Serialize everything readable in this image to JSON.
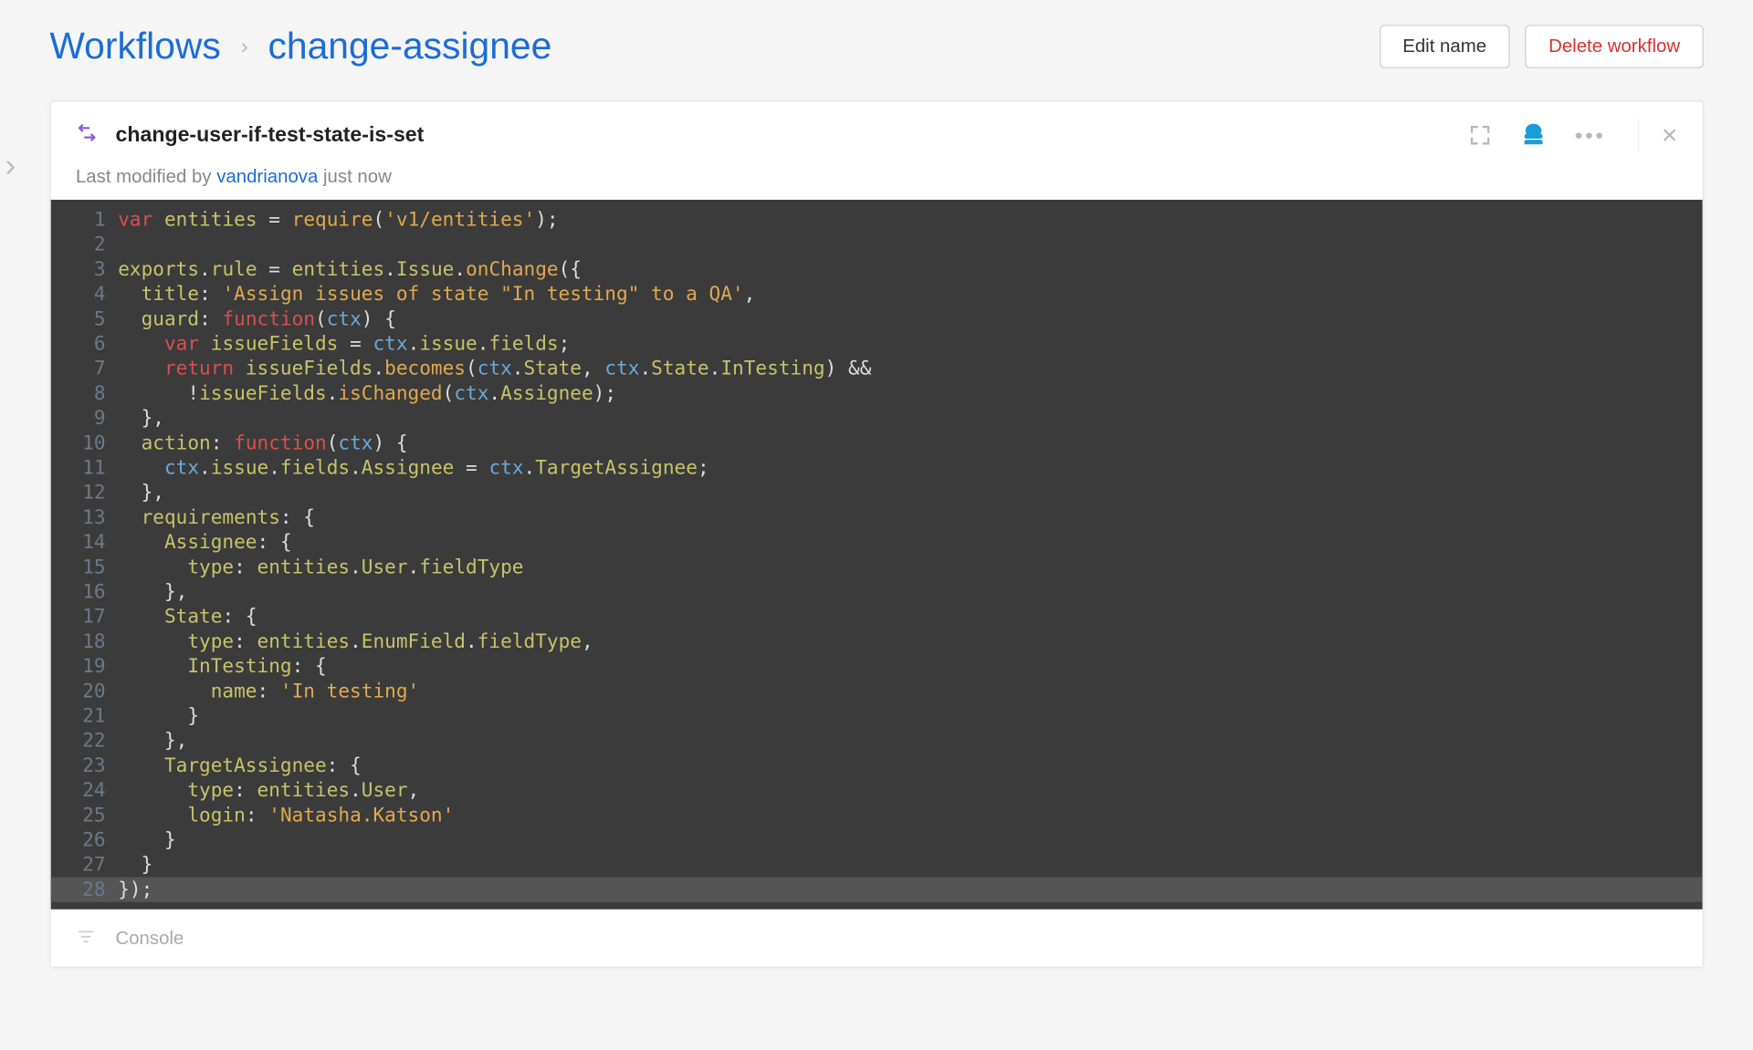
{
  "breadcrumb": {
    "root": "Workflows",
    "current": "change-assignee"
  },
  "buttons": {
    "edit": "Edit name",
    "delete": "Delete workflow"
  },
  "panel": {
    "title": "change-user-if-test-state-is-set",
    "meta_prefix": "Last modified by ",
    "meta_user": "vandrianova",
    "meta_time": " just now"
  },
  "console": {
    "label": "Console"
  },
  "code": [
    [
      [
        "kw",
        "var"
      ],
      [
        "op",
        " "
      ],
      [
        "prop",
        "entities"
      ],
      [
        "op",
        " "
      ],
      [
        "punc",
        "="
      ],
      [
        "op",
        " "
      ],
      [
        "fn",
        "require"
      ],
      [
        "punc",
        "("
      ],
      [
        "str",
        "'v1/entities'"
      ],
      [
        "punc",
        ");"
      ]
    ],
    [],
    [
      [
        "prop",
        "exports"
      ],
      [
        "punc",
        "."
      ],
      [
        "prop",
        "rule"
      ],
      [
        "op",
        " "
      ],
      [
        "punc",
        "="
      ],
      [
        "op",
        " "
      ],
      [
        "prop",
        "entities"
      ],
      [
        "punc",
        "."
      ],
      [
        "prop",
        "Issue"
      ],
      [
        "punc",
        "."
      ],
      [
        "fn",
        "onChange"
      ],
      [
        "punc",
        "({"
      ]
    ],
    [
      [
        "op",
        "  "
      ],
      [
        "prop",
        "title"
      ],
      [
        "punc",
        ":"
      ],
      [
        "op",
        " "
      ],
      [
        "str",
        "'Assign issues of state \"In testing\" to a QA'"
      ],
      [
        "punc",
        ","
      ]
    ],
    [
      [
        "op",
        "  "
      ],
      [
        "prop",
        "guard"
      ],
      [
        "punc",
        ":"
      ],
      [
        "op",
        " "
      ],
      [
        "kw",
        "function"
      ],
      [
        "punc",
        "("
      ],
      [
        "id",
        "ctx"
      ],
      [
        "punc",
        ")"
      ],
      [
        "op",
        " "
      ],
      [
        "punc",
        "{"
      ]
    ],
    [
      [
        "op",
        "    "
      ],
      [
        "kw",
        "var"
      ],
      [
        "op",
        " "
      ],
      [
        "prop",
        "issueFields"
      ],
      [
        "op",
        " "
      ],
      [
        "punc",
        "="
      ],
      [
        "op",
        " "
      ],
      [
        "id",
        "ctx"
      ],
      [
        "punc",
        "."
      ],
      [
        "prop",
        "issue"
      ],
      [
        "punc",
        "."
      ],
      [
        "prop",
        "fields"
      ],
      [
        "punc",
        ";"
      ]
    ],
    [
      [
        "op",
        "    "
      ],
      [
        "kw",
        "return"
      ],
      [
        "op",
        " "
      ],
      [
        "prop",
        "issueFields"
      ],
      [
        "punc",
        "."
      ],
      [
        "fn",
        "becomes"
      ],
      [
        "punc",
        "("
      ],
      [
        "id",
        "ctx"
      ],
      [
        "punc",
        "."
      ],
      [
        "prop",
        "State"
      ],
      [
        "punc",
        ","
      ],
      [
        "op",
        " "
      ],
      [
        "id",
        "ctx"
      ],
      [
        "punc",
        "."
      ],
      [
        "prop",
        "State"
      ],
      [
        "punc",
        "."
      ],
      [
        "prop",
        "InTesting"
      ],
      [
        "punc",
        ")"
      ],
      [
        "op",
        " "
      ],
      [
        "punc",
        "&&"
      ]
    ],
    [
      [
        "op",
        "      "
      ],
      [
        "punc",
        "!"
      ],
      [
        "prop",
        "issueFields"
      ],
      [
        "punc",
        "."
      ],
      [
        "fn",
        "isChanged"
      ],
      [
        "punc",
        "("
      ],
      [
        "id",
        "ctx"
      ],
      [
        "punc",
        "."
      ],
      [
        "prop",
        "Assignee"
      ],
      [
        "punc",
        ");"
      ]
    ],
    [
      [
        "op",
        "  "
      ],
      [
        "punc",
        "},"
      ]
    ],
    [
      [
        "op",
        "  "
      ],
      [
        "prop",
        "action"
      ],
      [
        "punc",
        ":"
      ],
      [
        "op",
        " "
      ],
      [
        "kw",
        "function"
      ],
      [
        "punc",
        "("
      ],
      [
        "id",
        "ctx"
      ],
      [
        "punc",
        ")"
      ],
      [
        "op",
        " "
      ],
      [
        "punc",
        "{"
      ]
    ],
    [
      [
        "op",
        "    "
      ],
      [
        "id",
        "ctx"
      ],
      [
        "punc",
        "."
      ],
      [
        "prop",
        "issue"
      ],
      [
        "punc",
        "."
      ],
      [
        "prop",
        "fields"
      ],
      [
        "punc",
        "."
      ],
      [
        "prop",
        "Assignee"
      ],
      [
        "op",
        " "
      ],
      [
        "punc",
        "="
      ],
      [
        "op",
        " "
      ],
      [
        "id",
        "ctx"
      ],
      [
        "punc",
        "."
      ],
      [
        "prop",
        "TargetAssignee"
      ],
      [
        "punc",
        ";"
      ]
    ],
    [
      [
        "op",
        "  "
      ],
      [
        "punc",
        "},"
      ]
    ],
    [
      [
        "op",
        "  "
      ],
      [
        "prop",
        "requirements"
      ],
      [
        "punc",
        ":"
      ],
      [
        "op",
        " "
      ],
      [
        "punc",
        "{"
      ]
    ],
    [
      [
        "op",
        "    "
      ],
      [
        "prop",
        "Assignee"
      ],
      [
        "punc",
        ":"
      ],
      [
        "op",
        " "
      ],
      [
        "punc",
        "{"
      ]
    ],
    [
      [
        "op",
        "      "
      ],
      [
        "prop",
        "type"
      ],
      [
        "punc",
        ":"
      ],
      [
        "op",
        " "
      ],
      [
        "prop",
        "entities"
      ],
      [
        "punc",
        "."
      ],
      [
        "prop",
        "User"
      ],
      [
        "punc",
        "."
      ],
      [
        "prop",
        "fieldType"
      ]
    ],
    [
      [
        "op",
        "    "
      ],
      [
        "punc",
        "},"
      ]
    ],
    [
      [
        "op",
        "    "
      ],
      [
        "prop",
        "State"
      ],
      [
        "punc",
        ":"
      ],
      [
        "op",
        " "
      ],
      [
        "punc",
        "{"
      ]
    ],
    [
      [
        "op",
        "      "
      ],
      [
        "prop",
        "type"
      ],
      [
        "punc",
        ":"
      ],
      [
        "op",
        " "
      ],
      [
        "prop",
        "entities"
      ],
      [
        "punc",
        "."
      ],
      [
        "prop",
        "EnumField"
      ],
      [
        "punc",
        "."
      ],
      [
        "prop",
        "fieldType"
      ],
      [
        "punc",
        ","
      ]
    ],
    [
      [
        "op",
        "      "
      ],
      [
        "prop",
        "InTesting"
      ],
      [
        "punc",
        ":"
      ],
      [
        "op",
        " "
      ],
      [
        "punc",
        "{"
      ]
    ],
    [
      [
        "op",
        "        "
      ],
      [
        "prop",
        "name"
      ],
      [
        "punc",
        ":"
      ],
      [
        "op",
        " "
      ],
      [
        "str",
        "'In testing'"
      ]
    ],
    [
      [
        "op",
        "      "
      ],
      [
        "punc",
        "}"
      ]
    ],
    [
      [
        "op",
        "    "
      ],
      [
        "punc",
        "},"
      ]
    ],
    [
      [
        "op",
        "    "
      ],
      [
        "prop",
        "TargetAssignee"
      ],
      [
        "punc",
        ":"
      ],
      [
        "op",
        " "
      ],
      [
        "punc",
        "{"
      ]
    ],
    [
      [
        "op",
        "      "
      ],
      [
        "prop",
        "type"
      ],
      [
        "punc",
        ":"
      ],
      [
        "op",
        " "
      ],
      [
        "prop",
        "entities"
      ],
      [
        "punc",
        "."
      ],
      [
        "prop",
        "User"
      ],
      [
        "punc",
        ","
      ]
    ],
    [
      [
        "op",
        "      "
      ],
      [
        "prop",
        "login"
      ],
      [
        "punc",
        ":"
      ],
      [
        "op",
        " "
      ],
      [
        "str",
        "'Natasha.Katson'"
      ]
    ],
    [
      [
        "op",
        "    "
      ],
      [
        "punc",
        "}"
      ]
    ],
    [
      [
        "op",
        "  "
      ],
      [
        "punc",
        "}"
      ]
    ],
    [
      [
        "punc",
        "});"
      ]
    ]
  ],
  "cursor_line": 28
}
